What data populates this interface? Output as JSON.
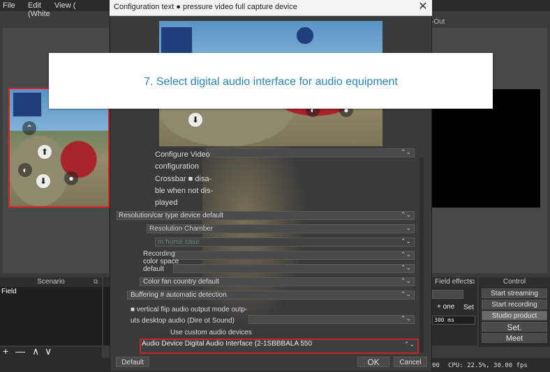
{
  "menubar": {
    "file": "File",
    "edit": "Edit\n(White",
    "view": "View (",
    "partial_right": ""
  },
  "preview": {
    "out_label": "-Out"
  },
  "dialog": {
    "title": "Configuration text ● pressure video full capture device",
    "close_icon": "close-icon",
    "configure_video_label": "Configure Video\nconfiguration",
    "crossbar_label": "Crossbar ■ disa-\nble when not dis-\nplayed",
    "resolution_type": "Resolution/car type device default",
    "resolution_chamber": "Resolution Chamber",
    "horse_case": "m horse case",
    "recording_colorspace": "Recording\ncolor space\ndefault",
    "color_fan": "Color fan country default",
    "buffering": "Buffering # automatic detection",
    "vflip_audio": "■ vertical flip audio output mode outp-\nuts desktop audio (Dire ot Sound)",
    "use_custom_audio": "Use custom audio devices",
    "audio_device": "Audio Device Digital Audio Interface (2-1SBBBALA 550",
    "default_button": "Default",
    "ok_button": "OK",
    "cancel_button": "Cancel"
  },
  "banner": {
    "text": "7. Select digital audio interface for audio equipment"
  },
  "docks": {
    "scenario_title": "Scenario",
    "scenario_item": "Field",
    "field_effects_title": "Field effects",
    "control_title": "Control",
    "add_one": "+ one",
    "set_label": "Set",
    "duration_value": "300 ms",
    "start_streaming": "Start streaming",
    "start_recording": "Start recording",
    "studio_product": "Studio product",
    "set_button": "Set.",
    "meet_button": "Meet"
  },
  "status": {
    "cpu": "CPU: 22.5%, 30.00 fps",
    "left_frag": "00"
  },
  "scene_tools": {
    "add": "+",
    "remove": "—",
    "up": "∧",
    "down": "∨"
  },
  "colors": {
    "highlight_red": "#c0282b",
    "banner_text": "#2a86b8",
    "dark_bg": "#3b3b3b"
  }
}
